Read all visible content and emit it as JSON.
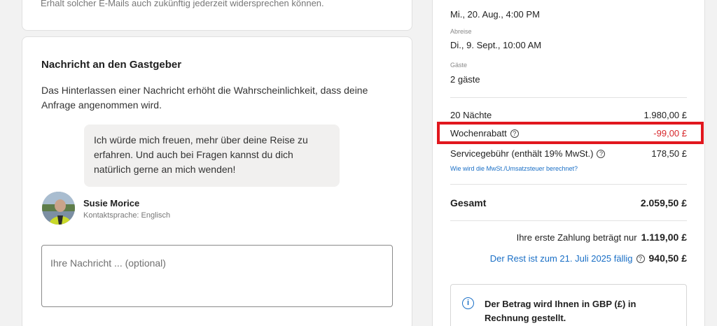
{
  "consent": {
    "text": "Erhalt solcher E-Mails auch zukünftig jederzeit widersprechen können."
  },
  "message_section": {
    "title": "Nachricht an den Gastgeber",
    "intro": "Das Hinterlassen einer Nachricht erhöht die Wahrscheinlichkeit, dass deine Anfrage angenommen wird.",
    "host_message": "Ich würde mich freuen, mehr über deine Reise zu erfahren. Und auch bei Fragen kannst du dich natürlich gerne an mich wenden!",
    "host_name": "Susie Morice",
    "host_language": "Kontaktsprache: Englisch",
    "input_placeholder": "Ihre Nachricht ... (optional)"
  },
  "summary": {
    "arrival_value": "Mi., 20. Aug., 4:00 PM",
    "departure_label": "Abreise",
    "departure_value": "Di., 9. Sept., 10:00 AM",
    "guests_label": "Gäste",
    "guests_value": "2 gäste",
    "nights_label": "20 Nächte",
    "nights_value": "1.980,00 £",
    "discount_label": "Wochenrabatt",
    "discount_value": "-99,00 £",
    "service_label": "Servicegebühr (enthält 19% MwSt.)",
    "service_value": "178,50 £",
    "vat_link": "Wie wird die MwSt./Umsatzsteuer berechnet?",
    "total_label": "Gesamt",
    "total_value": "2.059,50 £",
    "first_payment_label": "Ihre erste Zahlung beträgt nur",
    "first_payment_value": "1.119,00 £",
    "rest_label": "Der Rest ist zum 21. Juli 2025 fällig",
    "rest_value": "940,50 £",
    "info_text": "Der Betrag wird Ihnen in GBP (£) in Rechnung gestellt."
  },
  "colors": {
    "highlight": "#e1171e",
    "link": "#1a6fc6",
    "discount": "#d7262b"
  },
  "icons": {
    "help": "question-circle-icon",
    "info": "info-circle-icon"
  }
}
